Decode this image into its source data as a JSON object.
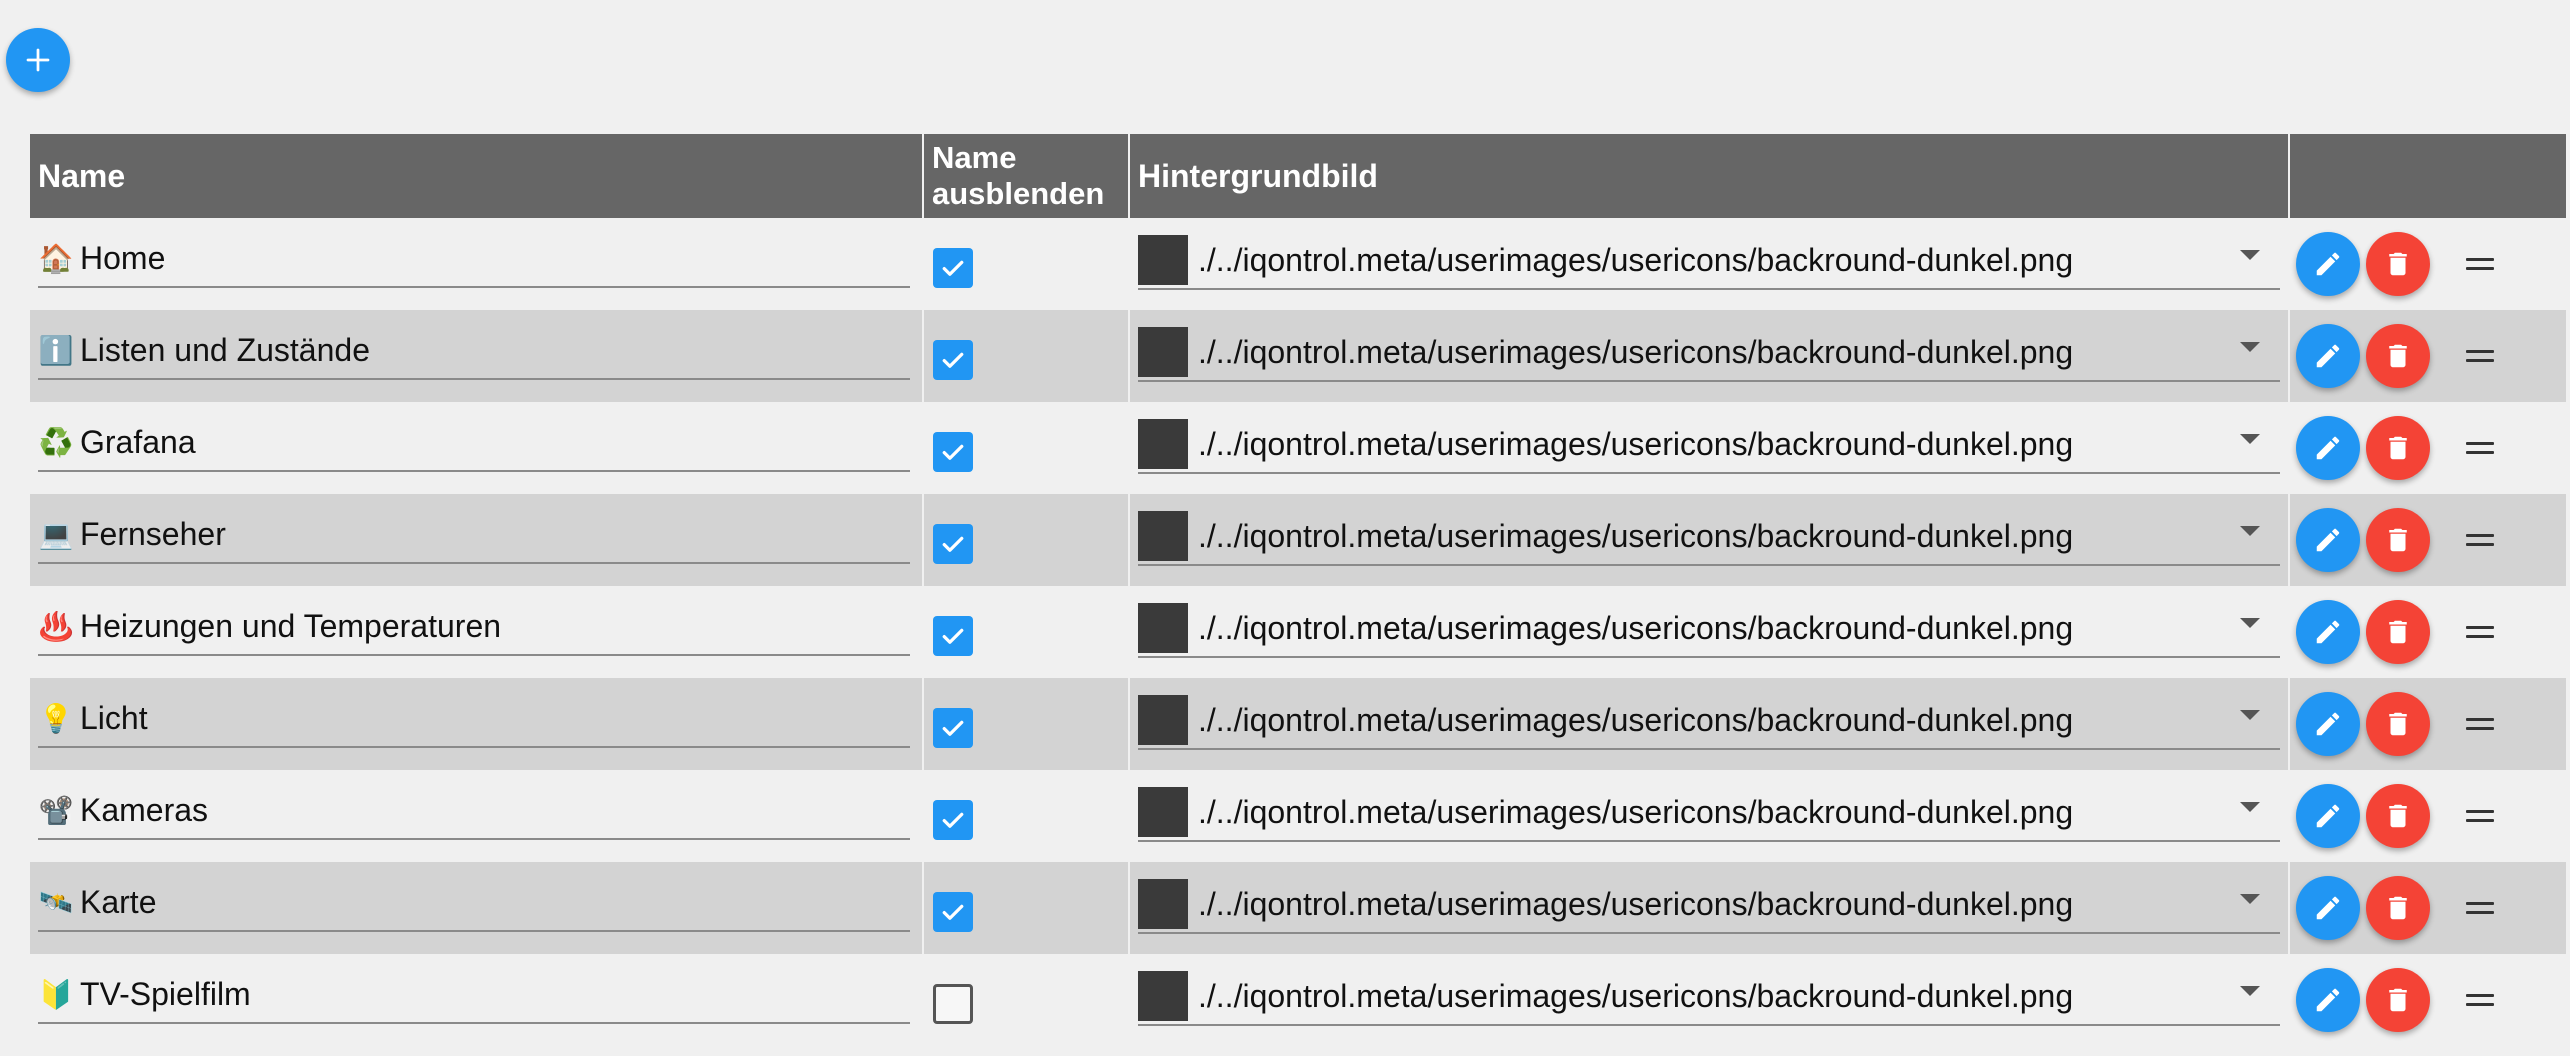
{
  "header": {
    "name": "Name",
    "hide_name_line1": "Name",
    "hide_name_line2": "ausblenden",
    "background": "Hintergrundbild"
  },
  "add_button": {
    "icon": "plus-icon"
  },
  "colors": {
    "header_bg": "#666666",
    "row_even": "#d3d3d3",
    "row_odd": "#f0f0f0",
    "primary": "#2196f3",
    "danger": "#f44336",
    "thumb": "#3a3a3a"
  },
  "rows": [
    {
      "emoji": "🏠",
      "name": "Home",
      "hide_name": true,
      "background": "./../iqontrol.meta/userimages/usericons/backround-dunkel.png"
    },
    {
      "emoji": "ℹ️",
      "name": "Listen und Zustände",
      "hide_name": true,
      "background": "./../iqontrol.meta/userimages/usericons/backround-dunkel.png"
    },
    {
      "emoji": "♻️",
      "name": "Grafana",
      "hide_name": true,
      "background": "./../iqontrol.meta/userimages/usericons/backround-dunkel.png"
    },
    {
      "emoji": "💻",
      "name": "Fernseher",
      "hide_name": true,
      "background": "./../iqontrol.meta/userimages/usericons/backround-dunkel.png"
    },
    {
      "emoji": "♨️",
      "name": "Heizungen und Temperaturen",
      "hide_name": true,
      "background": "./../iqontrol.meta/userimages/usericons/backround-dunkel.png"
    },
    {
      "emoji": "💡",
      "name": "Licht",
      "hide_name": true,
      "background": "./../iqontrol.meta/userimages/usericons/backround-dunkel.png"
    },
    {
      "emoji": "📽️",
      "name": "Kameras",
      "hide_name": true,
      "background": "./../iqontrol.meta/userimages/usericons/backround-dunkel.png"
    },
    {
      "emoji": "🛰️",
      "name": "Karte",
      "hide_name": true,
      "background": "./../iqontrol.meta/userimages/usericons/backround-dunkel.png"
    },
    {
      "emoji": "🔰",
      "name": "TV-Spielfilm",
      "hide_name": false,
      "background": "./../iqontrol.meta/userimages/usericons/backround-dunkel.png"
    }
  ]
}
